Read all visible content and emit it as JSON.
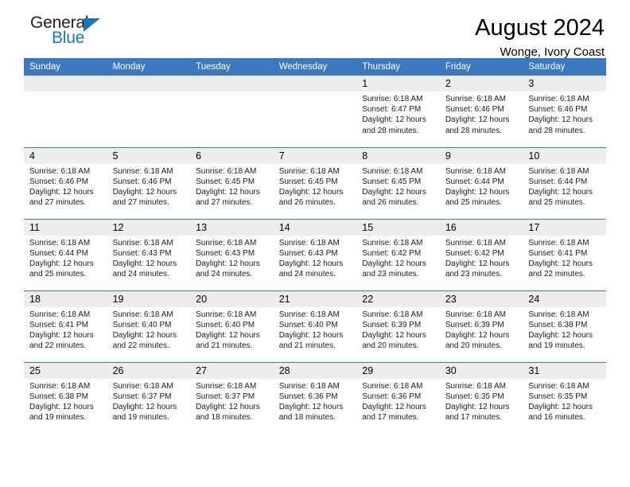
{
  "brand": {
    "name_part1": "General",
    "name_part2": "Blue",
    "accent_color": "#1b75bc"
  },
  "header": {
    "month_title": "August 2024",
    "location": "Wonge, Ivory Coast"
  },
  "calendar": {
    "header_color": "#3b78bf",
    "daynum_band_color": "#ededed",
    "weekday_headers": [
      "Sunday",
      "Monday",
      "Tuesday",
      "Wednesday",
      "Thursday",
      "Friday",
      "Saturday"
    ],
    "weeks": [
      [
        {
          "day": "",
          "empty": true
        },
        {
          "day": "",
          "empty": true
        },
        {
          "day": "",
          "empty": true
        },
        {
          "day": "",
          "empty": true
        },
        {
          "day": "1",
          "sunrise": "Sunrise: 6:18 AM",
          "sunset": "Sunset: 6:47 PM",
          "daylight_line1": "Daylight: 12 hours",
          "daylight_line2": "and 28 minutes."
        },
        {
          "day": "2",
          "sunrise": "Sunrise: 6:18 AM",
          "sunset": "Sunset: 6:46 PM",
          "daylight_line1": "Daylight: 12 hours",
          "daylight_line2": "and 28 minutes."
        },
        {
          "day": "3",
          "sunrise": "Sunrise: 6:18 AM",
          "sunset": "Sunset: 6:46 PM",
          "daylight_line1": "Daylight: 12 hours",
          "daylight_line2": "and 28 minutes."
        }
      ],
      [
        {
          "day": "4",
          "sunrise": "Sunrise: 6:18 AM",
          "sunset": "Sunset: 6:46 PM",
          "daylight_line1": "Daylight: 12 hours",
          "daylight_line2": "and 27 minutes."
        },
        {
          "day": "5",
          "sunrise": "Sunrise: 6:18 AM",
          "sunset": "Sunset: 6:46 PM",
          "daylight_line1": "Daylight: 12 hours",
          "daylight_line2": "and 27 minutes."
        },
        {
          "day": "6",
          "sunrise": "Sunrise: 6:18 AM",
          "sunset": "Sunset: 6:45 PM",
          "daylight_line1": "Daylight: 12 hours",
          "daylight_line2": "and 27 minutes."
        },
        {
          "day": "7",
          "sunrise": "Sunrise: 6:18 AM",
          "sunset": "Sunset: 6:45 PM",
          "daylight_line1": "Daylight: 12 hours",
          "daylight_line2": "and 26 minutes."
        },
        {
          "day": "8",
          "sunrise": "Sunrise: 6:18 AM",
          "sunset": "Sunset: 6:45 PM",
          "daylight_line1": "Daylight: 12 hours",
          "daylight_line2": "and 26 minutes."
        },
        {
          "day": "9",
          "sunrise": "Sunrise: 6:18 AM",
          "sunset": "Sunset: 6:44 PM",
          "daylight_line1": "Daylight: 12 hours",
          "daylight_line2": "and 25 minutes."
        },
        {
          "day": "10",
          "sunrise": "Sunrise: 6:18 AM",
          "sunset": "Sunset: 6:44 PM",
          "daylight_line1": "Daylight: 12 hours",
          "daylight_line2": "and 25 minutes."
        }
      ],
      [
        {
          "day": "11",
          "sunrise": "Sunrise: 6:18 AM",
          "sunset": "Sunset: 6:44 PM",
          "daylight_line1": "Daylight: 12 hours",
          "daylight_line2": "and 25 minutes."
        },
        {
          "day": "12",
          "sunrise": "Sunrise: 6:18 AM",
          "sunset": "Sunset: 6:43 PM",
          "daylight_line1": "Daylight: 12 hours",
          "daylight_line2": "and 24 minutes."
        },
        {
          "day": "13",
          "sunrise": "Sunrise: 6:18 AM",
          "sunset": "Sunset: 6:43 PM",
          "daylight_line1": "Daylight: 12 hours",
          "daylight_line2": "and 24 minutes."
        },
        {
          "day": "14",
          "sunrise": "Sunrise: 6:18 AM",
          "sunset": "Sunset: 6:43 PM",
          "daylight_line1": "Daylight: 12 hours",
          "daylight_line2": "and 24 minutes."
        },
        {
          "day": "15",
          "sunrise": "Sunrise: 6:18 AM",
          "sunset": "Sunset: 6:42 PM",
          "daylight_line1": "Daylight: 12 hours",
          "daylight_line2": "and 23 minutes."
        },
        {
          "day": "16",
          "sunrise": "Sunrise: 6:18 AM",
          "sunset": "Sunset: 6:42 PM",
          "daylight_line1": "Daylight: 12 hours",
          "daylight_line2": "and 23 minutes."
        },
        {
          "day": "17",
          "sunrise": "Sunrise: 6:18 AM",
          "sunset": "Sunset: 6:41 PM",
          "daylight_line1": "Daylight: 12 hours",
          "daylight_line2": "and 22 minutes."
        }
      ],
      [
        {
          "day": "18",
          "sunrise": "Sunrise: 6:18 AM",
          "sunset": "Sunset: 6:41 PM",
          "daylight_line1": "Daylight: 12 hours",
          "daylight_line2": "and 22 minutes."
        },
        {
          "day": "19",
          "sunrise": "Sunrise: 6:18 AM",
          "sunset": "Sunset: 6:40 PM",
          "daylight_line1": "Daylight: 12 hours",
          "daylight_line2": "and 22 minutes."
        },
        {
          "day": "20",
          "sunrise": "Sunrise: 6:18 AM",
          "sunset": "Sunset: 6:40 PM",
          "daylight_line1": "Daylight: 12 hours",
          "daylight_line2": "and 21 minutes."
        },
        {
          "day": "21",
          "sunrise": "Sunrise: 6:18 AM",
          "sunset": "Sunset: 6:40 PM",
          "daylight_line1": "Daylight: 12 hours",
          "daylight_line2": "and 21 minutes."
        },
        {
          "day": "22",
          "sunrise": "Sunrise: 6:18 AM",
          "sunset": "Sunset: 6:39 PM",
          "daylight_line1": "Daylight: 12 hours",
          "daylight_line2": "and 20 minutes."
        },
        {
          "day": "23",
          "sunrise": "Sunrise: 6:18 AM",
          "sunset": "Sunset: 6:39 PM",
          "daylight_line1": "Daylight: 12 hours",
          "daylight_line2": "and 20 minutes."
        },
        {
          "day": "24",
          "sunrise": "Sunrise: 6:18 AM",
          "sunset": "Sunset: 6:38 PM",
          "daylight_line1": "Daylight: 12 hours",
          "daylight_line2": "and 19 minutes."
        }
      ],
      [
        {
          "day": "25",
          "sunrise": "Sunrise: 6:18 AM",
          "sunset": "Sunset: 6:38 PM",
          "daylight_line1": "Daylight: 12 hours",
          "daylight_line2": "and 19 minutes."
        },
        {
          "day": "26",
          "sunrise": "Sunrise: 6:18 AM",
          "sunset": "Sunset: 6:37 PM",
          "daylight_line1": "Daylight: 12 hours",
          "daylight_line2": "and 19 minutes."
        },
        {
          "day": "27",
          "sunrise": "Sunrise: 6:18 AM",
          "sunset": "Sunset: 6:37 PM",
          "daylight_line1": "Daylight: 12 hours",
          "daylight_line2": "and 18 minutes."
        },
        {
          "day": "28",
          "sunrise": "Sunrise: 6:18 AM",
          "sunset": "Sunset: 6:36 PM",
          "daylight_line1": "Daylight: 12 hours",
          "daylight_line2": "and 18 minutes."
        },
        {
          "day": "29",
          "sunrise": "Sunrise: 6:18 AM",
          "sunset": "Sunset: 6:36 PM",
          "daylight_line1": "Daylight: 12 hours",
          "daylight_line2": "and 17 minutes."
        },
        {
          "day": "30",
          "sunrise": "Sunrise: 6:18 AM",
          "sunset": "Sunset: 6:35 PM",
          "daylight_line1": "Daylight: 12 hours",
          "daylight_line2": "and 17 minutes."
        },
        {
          "day": "31",
          "sunrise": "Sunrise: 6:18 AM",
          "sunset": "Sunset: 6:35 PM",
          "daylight_line1": "Daylight: 12 hours",
          "daylight_line2": "and 16 minutes."
        }
      ]
    ]
  }
}
